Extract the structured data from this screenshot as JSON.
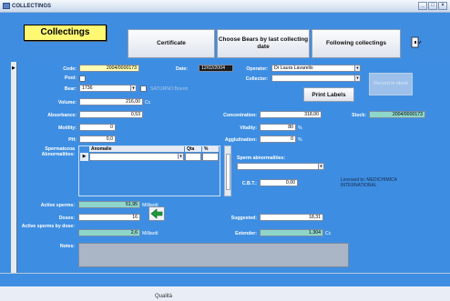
{
  "window": {
    "title": "COLLECTINGS"
  },
  "header": {
    "form_title": "Collectings",
    "buttons": {
      "certificate": "Certificate",
      "choose_bears": "Choose Bears by last collecting date",
      "following": "Following collectings"
    }
  },
  "form": {
    "code_label": "Code:",
    "code_value": "2004/0000173",
    "date_label": "Date:",
    "date_value": "12/02/2004",
    "operator_label": "Operator:",
    "operator_value": "Dr Laura Lavarello",
    "pool_label": "Pool:",
    "collector_label": "Collector:",
    "collector_value": "",
    "bear_label": "Bear:",
    "bear_value": "1736",
    "bear_name": "SATURNO Boerin",
    "print_labels": "Print Labels",
    "record_in_stock": "Record in stock",
    "volume_label": "Volume:",
    "volume_value": "216,00",
    "volume_unit": "Cc",
    "absorbance_label": "Absorbance:",
    "absorbance_value": "0,53",
    "concentration_label": "Concentration:",
    "concentration_value": "318,00",
    "stock_label": "Stock:",
    "stock_value": "2004/0000173",
    "motility_label": "Motility:",
    "motility_value": "0",
    "vitality_label": "Vitality:",
    "vitality_value": "80",
    "vitality_unit": "%",
    "ph_label": "PH:",
    "ph_value": "0,0",
    "agglutination_label": "Agglutination:",
    "agglutination_value": "0",
    "agglutination_unit": "%",
    "spermatozoa_label": "Spermatozoa Abnormalities:",
    "sub_col_anomaly": "Anomalie",
    "sub_col_qty": "Qta",
    "sub_col_pct": "%",
    "sperm_abn_label": "Sperm abnormalities:",
    "cbt_label": "C.B.T.:",
    "cbt_value": "0,00",
    "license_text": "Licensed to: MEDICHIMICA INTERNATIONAL",
    "active_sperm_label": "Active sperms:",
    "active_sperm_value": "51,95",
    "active_sperm_unit": "Milliardi",
    "doses_label": "Doses:",
    "doses_value": "16",
    "suggested_label": "Suggested:",
    "suggested_value": "18,31",
    "active_by_dose_label": "Active sperms by dose:",
    "active_by_dose_value": "2,6",
    "active_by_dose_unit": "Milliardi",
    "extender_label": "Extender:",
    "extender_value": "1.304",
    "extender_unit": "Cc",
    "notes_label": "Notes:"
  },
  "footer": {
    "text": "Qualità"
  }
}
